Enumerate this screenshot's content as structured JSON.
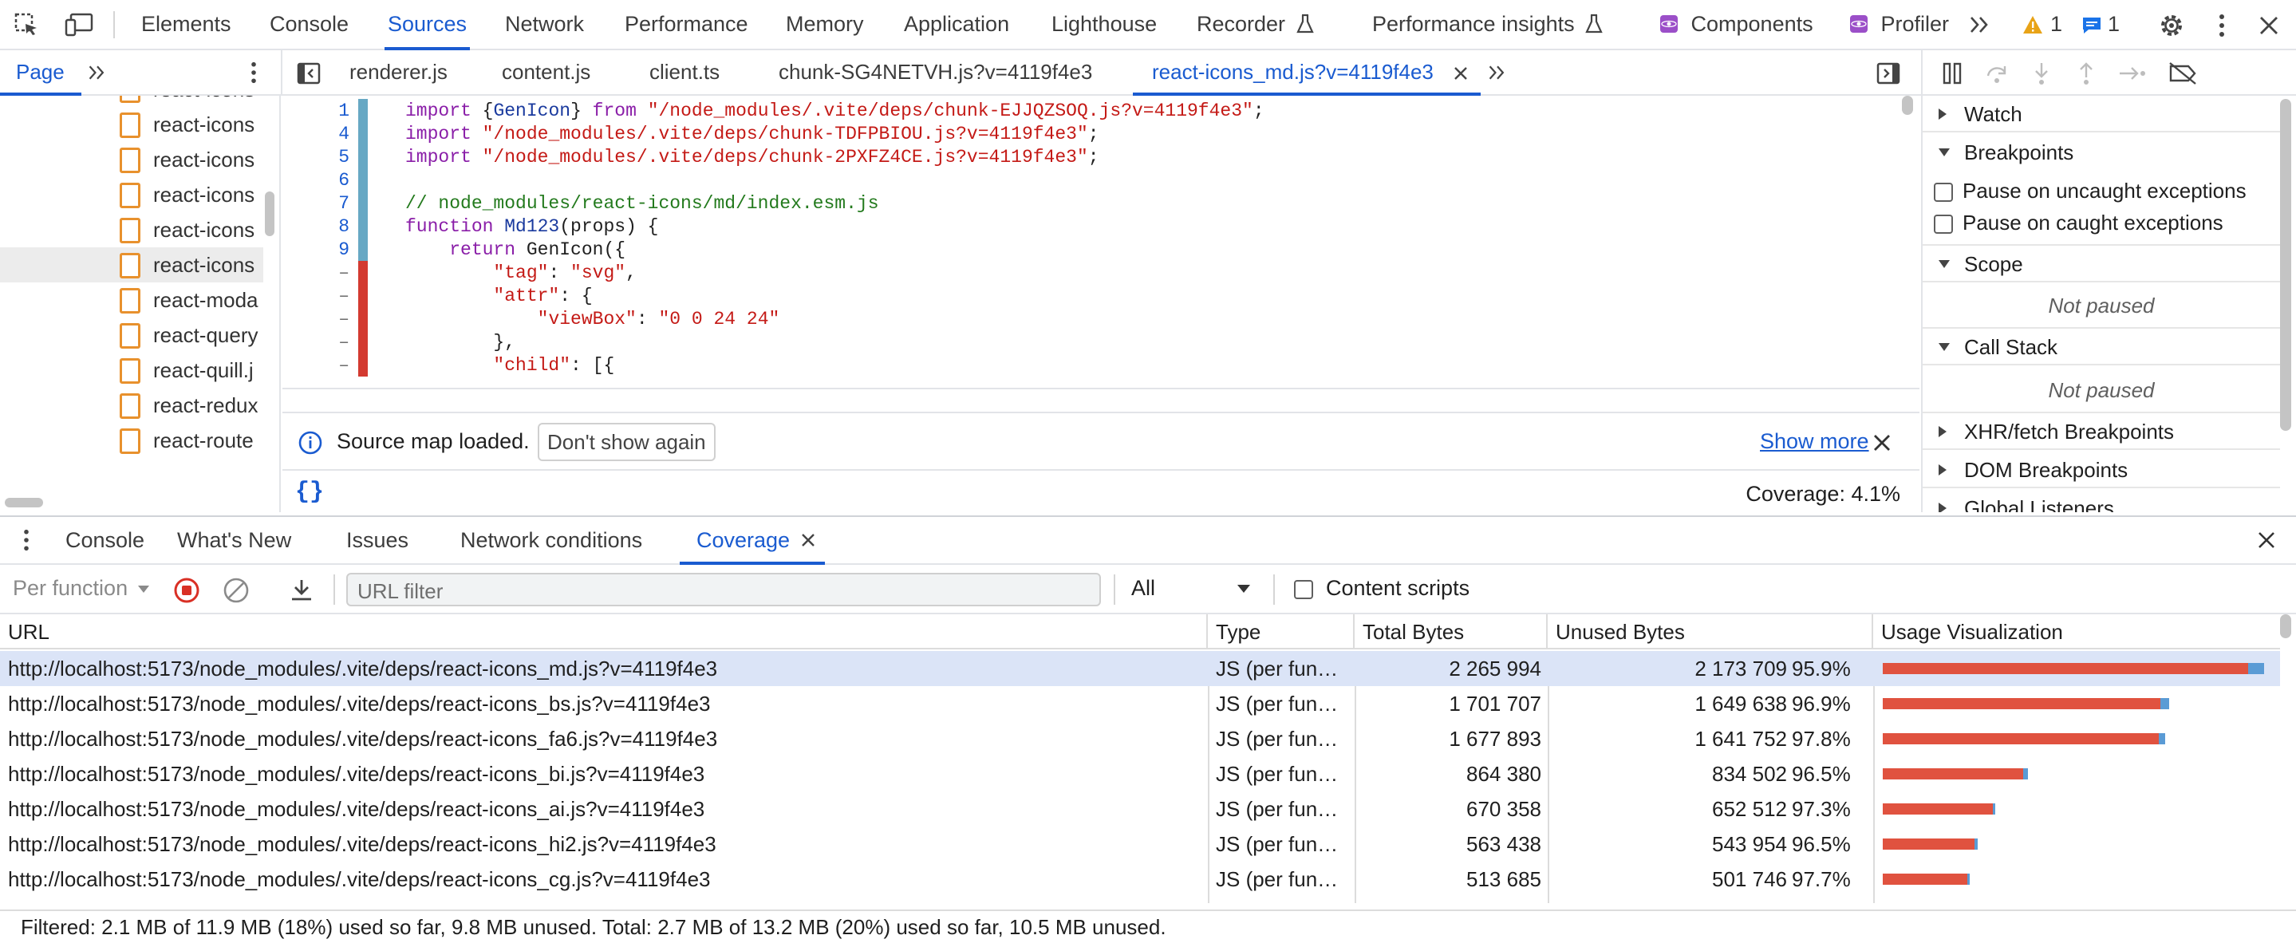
{
  "top_tabs": [
    "Elements",
    "Console",
    "Sources",
    "Network",
    "Performance",
    "Memory",
    "Application",
    "Lighthouse",
    "Recorder",
    "Performance insights",
    "Components",
    "Profiler"
  ],
  "warnings_count": "1",
  "messages_count": "1",
  "navigator": {
    "tab_label": "Page",
    "items": [
      "react-icons",
      "react-icons",
      "react-icons",
      "react-icons",
      "react-icons",
      "react-icons",
      "react-moda",
      "react-query",
      "react-quill.j",
      "react-redux",
      "react-route"
    ]
  },
  "file_tabs": [
    "renderer.js",
    "content.js",
    "client.ts",
    "chunk-SG4NETVH.js?v=4119f4e3",
    "react-icons_md.js?v=4119f4e3"
  ],
  "code_lines": {
    "n1": "1",
    "n4": "4",
    "n5": "5",
    "n6": "6",
    "n7": "7",
    "n8": "8",
    "n9": "9",
    "dash": "–",
    "l1_kw": "import",
    "l1_a": " {",
    "l1_b": "GenIcon",
    "l1_c": "} ",
    "l1_from": "from",
    "l1_str": " \"/node_modules/.vite/deps/chunk-EJJQZSOQ.js?v=4119f4e3\"",
    "l1_end": ";",
    "l4_kw": "import",
    "l4_str": " \"/node_modules/.vite/deps/chunk-TDFPBIOU.js?v=4119f4e3\"",
    "l4_end": ";",
    "l5_kw": "import",
    "l5_str": " \"/node_modules/.vite/deps/chunk-2PXFZ4CE.js?v=4119f4e3\"",
    "l5_end": ";",
    "l7": "// node_modules/react-icons/md/index.esm.js",
    "l8_kw": "function",
    "l8_fn": " Md123",
    "l8_rest": "(props) {",
    "l9_kw": "    return",
    "l9_rest": " GenIcon({",
    "d1_a": "        ",
    "d1_k": "\"tag\"",
    "d1_b": ": ",
    "d1_v": "\"svg\"",
    "d1_c": ",",
    "d2_a": "        ",
    "d2_k": "\"attr\"",
    "d2_b": ": {",
    "d3_a": "            ",
    "d3_k": "\"viewBox\"",
    "d3_b": ": ",
    "d3_v": "\"0 0 24 24\"",
    "d4": "        },",
    "d5_a": "        ",
    "d5_k": "\"child\"",
    "d5_b": ": [{"
  },
  "infobar": {
    "message": "Source map loaded.",
    "dismiss_button": "Don't show again",
    "show_more": "Show more"
  },
  "editor_status": {
    "format_label": "{}",
    "coverage": "Coverage: 4.1%"
  },
  "debugger": {
    "watch": "Watch",
    "breakpoints": "Breakpoints",
    "pause_uncaught": "Pause on uncaught exceptions",
    "pause_caught": "Pause on caught exceptions",
    "scope": "Scope",
    "scope_status": "Not paused",
    "call_stack": "Call Stack",
    "call_stack_status": "Not paused",
    "xhr": "XHR/fetch Breakpoints",
    "dom": "DOM Breakpoints",
    "global": "Global Listeners"
  },
  "drawer_tabs": [
    "Console",
    "What's New",
    "Issues",
    "Network conditions",
    "Coverage"
  ],
  "coverage_toolbar": {
    "mode": "Per function",
    "url_filter_placeholder": "URL filter",
    "type_filter": "All",
    "content_scripts": "Content scripts"
  },
  "coverage_table": {
    "headers": [
      "URL",
      "Type",
      "Total Bytes",
      "Unused Bytes",
      "Usage Visualization"
    ],
    "rows": [
      {
        "url": "http://localhost:5173/node_modules/.vite/deps/react-icons_md.js?v=4119f4e3",
        "type": "JS (per fun…",
        "total": "2 265 994",
        "unused": "2 173 709",
        "pct": "95.9%",
        "used_fraction": 0.041,
        "size_fraction": 1.0
      },
      {
        "url": "http://localhost:5173/node_modules/.vite/deps/react-icons_bs.js?v=4119f4e3",
        "type": "JS (per fun…",
        "total": "1 701 707",
        "unused": "1 649 638",
        "pct": "96.9%",
        "used_fraction": 0.031,
        "size_fraction": 0.751
      },
      {
        "url": "http://localhost:5173/node_modules/.vite/deps/react-icons_fa6.js?v=4119f4e3",
        "type": "JS (per fun…",
        "total": "1 677 893",
        "unused": "1 641 752",
        "pct": "97.8%",
        "used_fraction": 0.022,
        "size_fraction": 0.74
      },
      {
        "url": "http://localhost:5173/node_modules/.vite/deps/react-icons_bi.js?v=4119f4e3",
        "type": "JS (per fun…",
        "total": "864 380",
        "unused": "834 502",
        "pct": "96.5%",
        "used_fraction": 0.035,
        "size_fraction": 0.381
      },
      {
        "url": "http://localhost:5173/node_modules/.vite/deps/react-icons_ai.js?v=4119f4e3",
        "type": "JS (per fun…",
        "total": "670 358",
        "unused": "652 512",
        "pct": "97.3%",
        "used_fraction": 0.027,
        "size_fraction": 0.296
      },
      {
        "url": "http://localhost:5173/node_modules/.vite/deps/react-icons_hi2.js?v=4119f4e3",
        "type": "JS (per fun…",
        "total": "563 438",
        "unused": "543 954",
        "pct": "96.5%",
        "used_fraction": 0.035,
        "size_fraction": 0.249
      },
      {
        "url": "http://localhost:5173/node_modules/.vite/deps/react-icons_cg.js?v=4119f4e3",
        "type": "JS (per fun…",
        "total": "513 685",
        "unused": "501 746",
        "pct": "97.7%",
        "used_fraction": 0.023,
        "size_fraction": 0.227
      }
    ]
  },
  "status_bar": "Filtered: 2.1 MB of 11.9 MB (18%) used so far, 9.8 MB unused. Total: 2.7 MB of 13.2 MB (20%) used so far, 10.5 MB unused.",
  "colors": {
    "accent": "#1a5bd0",
    "unused_bar": "#e0523f",
    "used_bar": "#5a9bd5",
    "covered": "#67a8c4",
    "uncovered": "#d33a30"
  }
}
